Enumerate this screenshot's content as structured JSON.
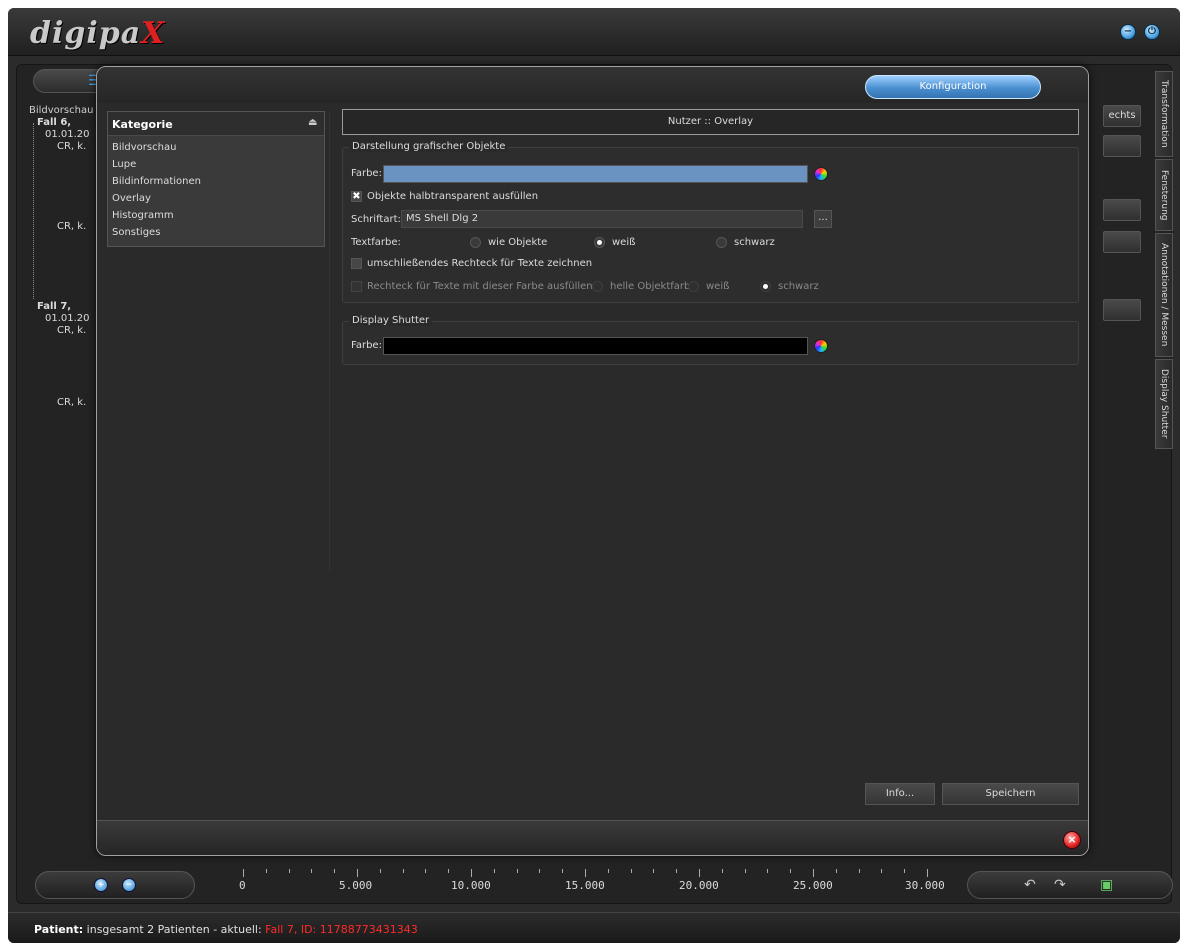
{
  "app": {
    "logo_main": "digipa",
    "logo_x": "X",
    "minimize_icon": "−",
    "power_icon": "⏻"
  },
  "tree": {
    "header": "Bildvorschau",
    "nodes": [
      "Fall 6,",
      "01.01.20",
      "CR, k.",
      "CR, k.",
      "Fall 7,",
      "01.01.20",
      "CR, k.",
      "CR, k."
    ]
  },
  "right_panel": {
    "button_label": "echts",
    "tabs": [
      "Transformation",
      "Fensterung",
      "Annotationen / Messen",
      "Display Shutter"
    ]
  },
  "ruler": {
    "labels": [
      "0",
      "5.000",
      "10.000",
      "15.000",
      "20.000",
      "25.000",
      "30.000"
    ]
  },
  "status": {
    "label": "Patient:",
    "text": "insgesamt 2 Patienten - aktuell:",
    "current": "Fall 7, ID: 11788773431343"
  },
  "dialog": {
    "config_button": "Konfiguration",
    "category_header": "Kategorie",
    "categories": [
      "Bildvorschau",
      "Lupe",
      "Bildinformationen",
      "Overlay",
      "Histogramm",
      "Sonstiges"
    ],
    "section_header": "Nutzer :: Overlay",
    "group1": {
      "title": "Darstellung grafischer Objekte",
      "color_label": "Farbe:",
      "color_value": "#6b93c2",
      "fill_checkbox": "Objekte halbtransparent ausfüllen",
      "font_label": "Schriftart:",
      "font_value": "MS Shell Dlg 2",
      "browse_button": "...",
      "textcolor_label": "Textfarbe:",
      "textcolor_options": [
        "wie Objekte",
        "weiß",
        "schwarz"
      ],
      "rect_checkbox": "umschließendes Rechteck für Texte zeichnen",
      "rectfill_checkbox": "Rechteck für Texte mit dieser Farbe ausfüllen:",
      "rectfill_options": [
        "helle Objektfarbe",
        "weiß",
        "schwarz"
      ]
    },
    "group2": {
      "title": "Display Shutter",
      "color_label": "Farbe:",
      "color_value": "#000000"
    },
    "info_button": "Info...",
    "save_button": "Speichern",
    "close_icon": "×"
  }
}
